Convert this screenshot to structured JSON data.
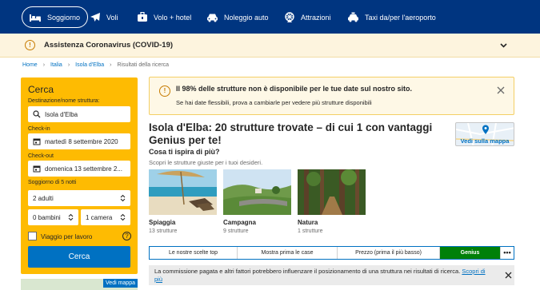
{
  "nav": {
    "tabs": [
      {
        "label": "Soggiorno",
        "icon": "bed-icon",
        "active": true
      },
      {
        "label": "Voli",
        "icon": "plane-icon",
        "active": false
      },
      {
        "label": "Volo + hotel",
        "icon": "suitcase-icon",
        "active": false
      },
      {
        "label": "Noleggio auto",
        "icon": "car-icon",
        "active": false
      },
      {
        "label": "Attrazioni",
        "icon": "attractions-icon",
        "active": false
      },
      {
        "label": "Taxi da/per l'aeroporto",
        "icon": "taxi-icon",
        "active": false
      }
    ]
  },
  "covid_banner": {
    "icon": "info-icon",
    "text": "Assistenza Coronavirus (COVID-19)"
  },
  "breadcrumbs": [
    "Home",
    "Italia",
    "Isola d'Elba",
    "Risultati della ricerca"
  ],
  "search": {
    "title": "Cerca",
    "destination_label": "Destinazione/nome struttura:",
    "destination_value": "Isola d'Elba",
    "checkin_label": "Check-in",
    "checkin_value": "martedì 8 settembre 2020",
    "checkout_label": "Check-out",
    "checkout_value": "domenica 13 settembre 2...",
    "stay_label": "Soggiorno di 5 notti",
    "adults_value": "2 adulti",
    "children_value": "0 bambini",
    "rooms_value": "1 camera",
    "business_label": "Viaggio per lavoro",
    "submit_label": "Cerca"
  },
  "map_thumb_label": "Vedi mappa",
  "alert": {
    "title": "Il 98% delle strutture non è disponibile per le tue date sul nostro sito.",
    "body": "Se hai date flessibili, prova a cambiarle per vedere più strutture disponibili"
  },
  "results": {
    "headline": "Isola d'Elba: 20 strutture trovate – di cui 1 con vantaggi Genius per te!",
    "map_button": "Vedi sulla mappa"
  },
  "inspire": {
    "title": "Cosa ti ispira di più?",
    "subtitle": "Scopri le strutture giuste per i tuoi desideri.",
    "cards": [
      {
        "title": "Spiaggia",
        "count": "13 strutture"
      },
      {
        "title": "Campagna",
        "count": "9 strutture"
      },
      {
        "title": "Natura",
        "count": "1 strutture"
      }
    ]
  },
  "sort": {
    "tabs": [
      "Le nostre scelte top",
      "Mostra prima le case",
      "Prezzo (prima il più basso)",
      "Genius"
    ],
    "more": "•••"
  },
  "disclaimer": {
    "text": "La commissione pagata e altri fattori potrebbero influenzare il posizionamento di una struttura nei risultati di ricerca.",
    "link": "Scopri di più"
  },
  "colors": {
    "brand_blue": "#003580",
    "link_blue": "#0071c2",
    "search_yellow": "#febb02",
    "genius_green": "#008009"
  }
}
